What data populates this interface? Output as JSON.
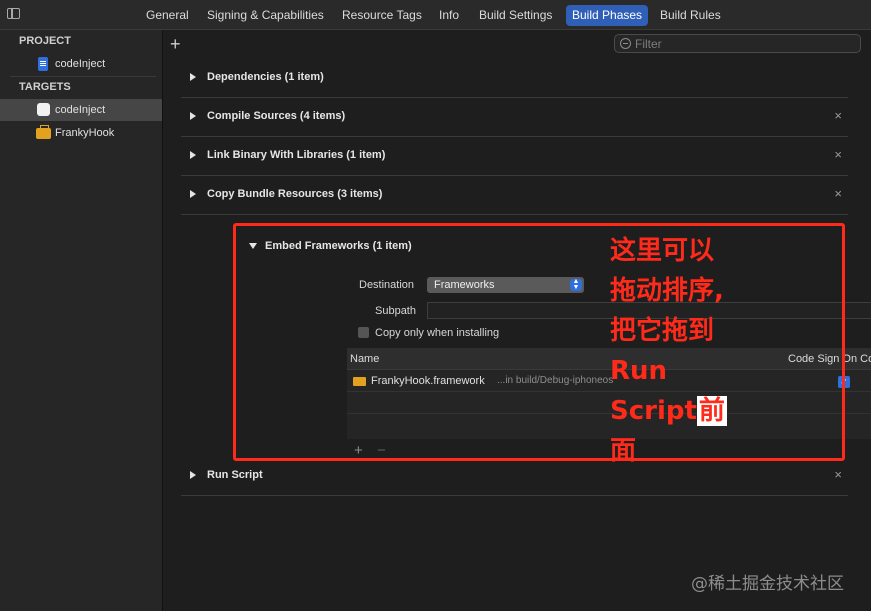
{
  "tabs": [
    {
      "label": "General"
    },
    {
      "label": "Signing & Capabilities"
    },
    {
      "label": "Resource Tags"
    },
    {
      "label": "Info"
    },
    {
      "label": "Build Settings"
    },
    {
      "label": "Build Phases",
      "active": true
    },
    {
      "label": "Build Rules"
    }
  ],
  "sidebar": {
    "project_header": "PROJECT",
    "project_item": "codeInject",
    "targets_header": "TARGETS",
    "target_items": [
      "codeInject",
      "FrankyHook"
    ]
  },
  "toolbar": {
    "add": "+",
    "filter_placeholder": "Filter"
  },
  "phases": {
    "dependencies": "Dependencies (1 item)",
    "compile": "Compile Sources (4 items)",
    "link": "Link Binary With Libraries (1 item)",
    "copy": "Copy Bundle Resources (3 items)",
    "embed": "Embed Frameworks (1 item)",
    "run_script": "Run Script",
    "close": "×"
  },
  "embed": {
    "destination_label": "Destination",
    "destination_value": "Frameworks",
    "subpath_label": "Subpath",
    "copy_only_label": "Copy only when installing",
    "copy_only_checked": false,
    "table": {
      "col_name": "Name",
      "col_code_sign": "Code Sign On Copy",
      "rows": [
        {
          "name": "FrankyHook.framework",
          "path": "...in build/Debug-iphoneos",
          "code_sign": true
        }
      ]
    },
    "add": "+",
    "remove": "−"
  },
  "annotation": {
    "lines": [
      "这里可以",
      "拖动排序,",
      "把它拖到",
      "Run",
      "Script"
    ],
    "boxed": "前",
    "last": "面",
    "color": "#ff2a1a"
  },
  "watermark": "@稀土掘金技术社区",
  "colors": {
    "accent": "#2f5fb7",
    "highlight": "#ff2a1a"
  }
}
